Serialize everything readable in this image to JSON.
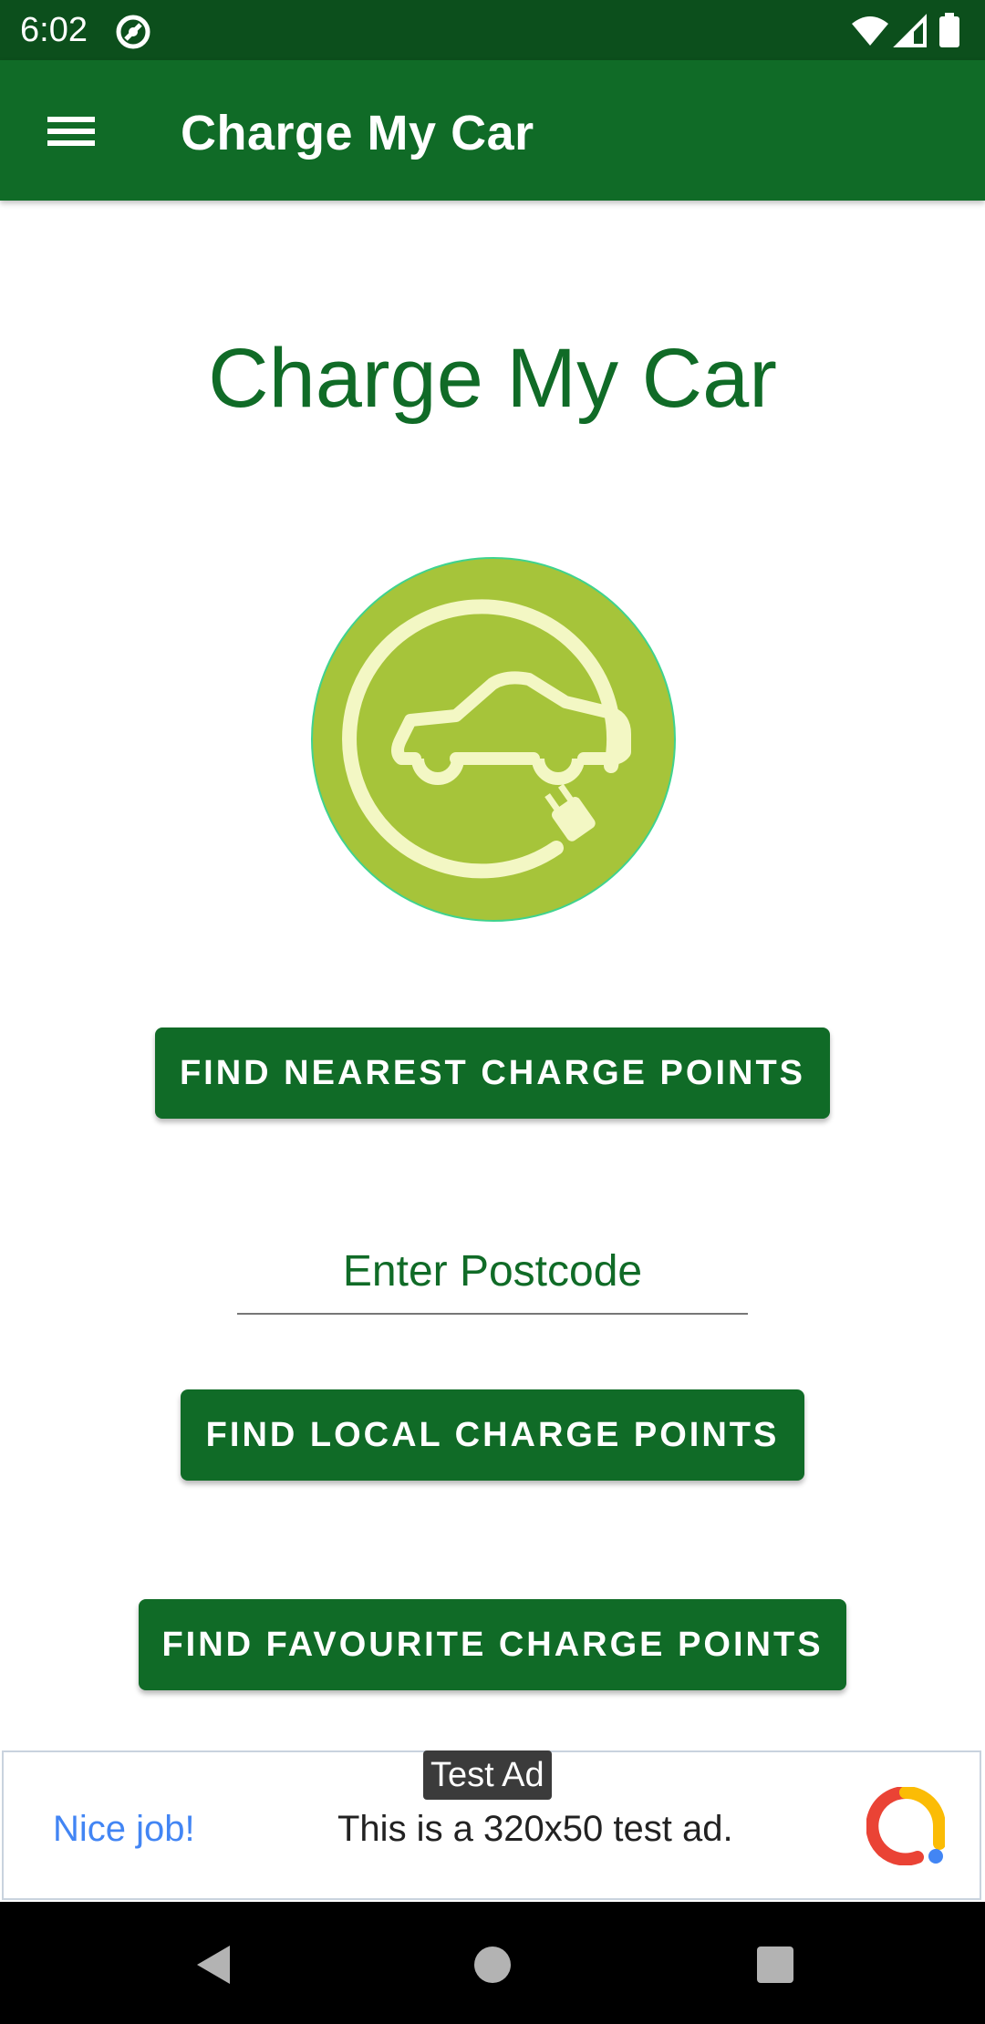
{
  "status_bar": {
    "time": "6:02",
    "icons": [
      "sync-icon",
      "wifi-icon",
      "signal-icon",
      "battery-icon"
    ]
  },
  "app_bar": {
    "title": "Charge My Car",
    "menu_icon": "hamburger-menu-icon"
  },
  "main": {
    "hero_title": "Charge My Car",
    "logo_icon": "ev-car-plug-icon",
    "find_nearest_label": "FIND NEAREST CHARGE POINTS",
    "postcode_placeholder": "Enter Postcode",
    "postcode_value": "",
    "find_local_label": "FIND LOCAL CHARGE POINTS",
    "find_favourite_label": "FIND FAVOURITE CHARGE POINTS"
  },
  "ad": {
    "tag": "Test Ad",
    "headline": "Nice job!",
    "body": "This is a 320x50 test ad.",
    "logo_icon": "ads-logo-icon"
  },
  "nav_bar": {
    "buttons": [
      "back-icon",
      "home-icon",
      "recents-icon"
    ]
  },
  "colors": {
    "status_bar": "#0c4f1c",
    "primary": "#106b27",
    "logo_circle": "#a6c43a",
    "logo_line": "#f3f7c4",
    "ad_blue": "#4285f4"
  }
}
